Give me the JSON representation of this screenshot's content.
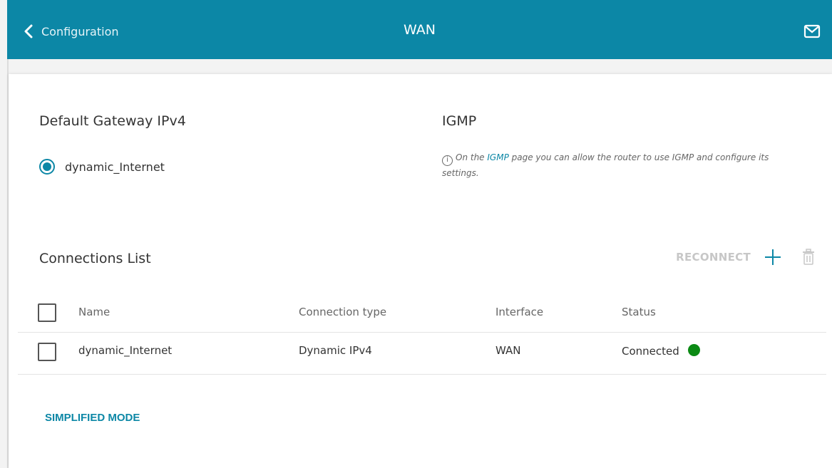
{
  "header": {
    "back_label": "Configuration",
    "title": "WAN",
    "mail_icon": "mail-icon"
  },
  "gateway": {
    "heading": "Default Gateway IPv4",
    "option": "dynamic_Internet",
    "selected": true
  },
  "igmp": {
    "heading": "IGMP",
    "note_before": "On the ",
    "note_link": "IGMP",
    "note_after": " page you can allow the router to use IGMP and configure its settings."
  },
  "connections": {
    "heading": "Connections List",
    "reconnect_label": "RECONNECT",
    "columns": [
      "Name",
      "Connection type",
      "Interface",
      "Status"
    ],
    "rows": [
      {
        "name": "dynamic_Internet",
        "type": "Dynamic IPv4",
        "interface": "WAN",
        "status": "Connected",
        "status_color": "#0b8a14"
      }
    ]
  },
  "footer": {
    "simplified_mode_label": "SIMPLIFIED MODE"
  },
  "colors": {
    "accent": "#0c87a6",
    "connected": "#0b8a14",
    "disabled": "#c7c7c7"
  }
}
